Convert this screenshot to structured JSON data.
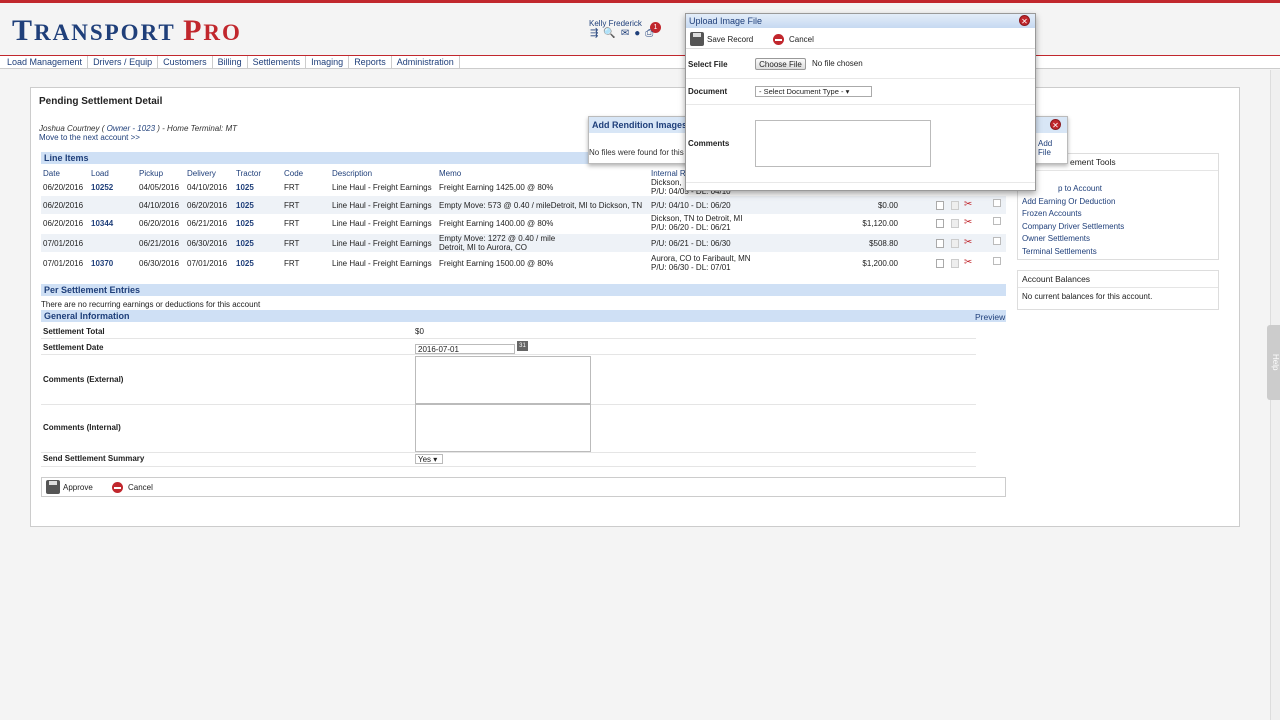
{
  "app": {
    "logo_part1": "T",
    "logo_part2": "RANSPORT ",
    "logo_part3": "P",
    "logo_part4": "RO",
    "user": "Kelly Frederick",
    "notifications": "1"
  },
  "nav": [
    "Load Management",
    "Drivers / Equip",
    "Customers",
    "Billing",
    "Settlements",
    "Imaging",
    "Reports",
    "Administration"
  ],
  "page": {
    "title": "Pending Settlement Detail",
    "person_name": "Joshua Courtney ( ",
    "person_link": "Owner - 1023",
    "person_rest": " ) - Home Terminal: MT",
    "next_account": "Move to the next account >>"
  },
  "line_items": {
    "header": "Line Items",
    "columns": [
      "Date",
      "Load",
      "Pickup",
      "Delivery",
      "Tractor",
      "Code",
      "Description",
      "Memo",
      "Internal R"
    ],
    "rows": [
      {
        "date": "06/20/2016",
        "load": "10252",
        "pickup": "04/05/2016",
        "delivery": "04/10/2016",
        "tractor": "1025",
        "code": "FRT",
        "desc": "Line Haul - Freight Earnings",
        "memo1": "Freight Earning 1425.00 @ 80%",
        "memo2": "",
        "ir1": "Dickson, ",
        "ir2": "P/U: 04/05 - DL: 04/10",
        "amount": ""
      },
      {
        "date": "06/20/2016",
        "load": "",
        "pickup": "04/10/2016",
        "delivery": "06/20/2016",
        "tractor": "1025",
        "code": "FRT",
        "desc": "Line Haul - Freight Earnings",
        "memo1": "Empty Move: 573 @ 0.40 / mileDetroit, MI to Dickson, TN",
        "memo2": "",
        "ir1": "P/U: 04/10 - DL: 06/20",
        "ir2": "",
        "amount": "$0.00"
      },
      {
        "date": "06/20/2016",
        "load": "10344",
        "pickup": "06/20/2016",
        "delivery": "06/21/2016",
        "tractor": "1025",
        "code": "FRT",
        "desc": "Line Haul - Freight Earnings",
        "memo1": "Freight Earning 1400.00 @ 80%",
        "memo2": "",
        "ir1": "Dickson, TN to Detroit, MI",
        "ir2": "P/U: 06/20 - DL: 06/21",
        "amount": "$1,120.00"
      },
      {
        "date": "07/01/2016",
        "load": "",
        "pickup": "06/21/2016",
        "delivery": "06/30/2016",
        "tractor": "1025",
        "code": "FRT",
        "desc": "Line Haul - Freight Earnings",
        "memo1": "Empty Move: 1272 @ 0.40 / mile",
        "memo2": "Detroit, MI to Aurora, CO",
        "ir1": "P/U: 06/21 - DL: 06/30",
        "ir2": "",
        "amount": "$508.80"
      },
      {
        "date": "07/01/2016",
        "load": "10370",
        "pickup": "06/30/2016",
        "delivery": "07/01/2016",
        "tractor": "1025",
        "code": "FRT",
        "desc": "Line Haul - Freight Earnings",
        "memo1": "Freight Earning 1500.00 @ 80%",
        "memo2": "",
        "ir1": "Aurora, CO to Faribault, MN",
        "ir2": "P/U: 06/30 - DL: 07/01",
        "amount": "$1,200.00"
      }
    ]
  },
  "per_settlement": {
    "header": "Per Settlement Entries",
    "empty": "There are no recurring earnings or deductions for this account"
  },
  "general": {
    "header": "General Information",
    "preview": "Preview",
    "total_label": "Settlement Total",
    "total_value": "$0",
    "date_label": "Settlement Date",
    "date_value": "2016-07-01",
    "cal_icon": "31",
    "comments_ext_label": "Comments (External)",
    "comments_int_label": "Comments (Internal)",
    "send_label": "Send Settlement Summary",
    "send_value": "Yes ▾"
  },
  "actions": {
    "approve": "Approve",
    "cancel": "Cancel"
  },
  "side": {
    "tools_header": "ement Tools",
    "tools": [
      "p to Account",
      "Add Earning Or Deduction",
      "Frozen Accounts",
      "Company Driver Settlements",
      "Owner Settlements",
      "Terminal Settlements"
    ],
    "balances_header": "Account Balances",
    "balances_empty": "No current balances for this account."
  },
  "rendition": {
    "title": "Add Rendition Images",
    "message": "No files were found for this",
    "add_file": "Add File"
  },
  "upload": {
    "title": "Upload Image File",
    "save": "Save Record",
    "cancel": "Cancel",
    "select_label": "Select File",
    "choose": "Choose File",
    "no_file": "No file chosen",
    "doc_label": "Document",
    "doc_value": "- Select Document Type -   ▾",
    "comments_label": "Comments"
  },
  "help": "Help"
}
